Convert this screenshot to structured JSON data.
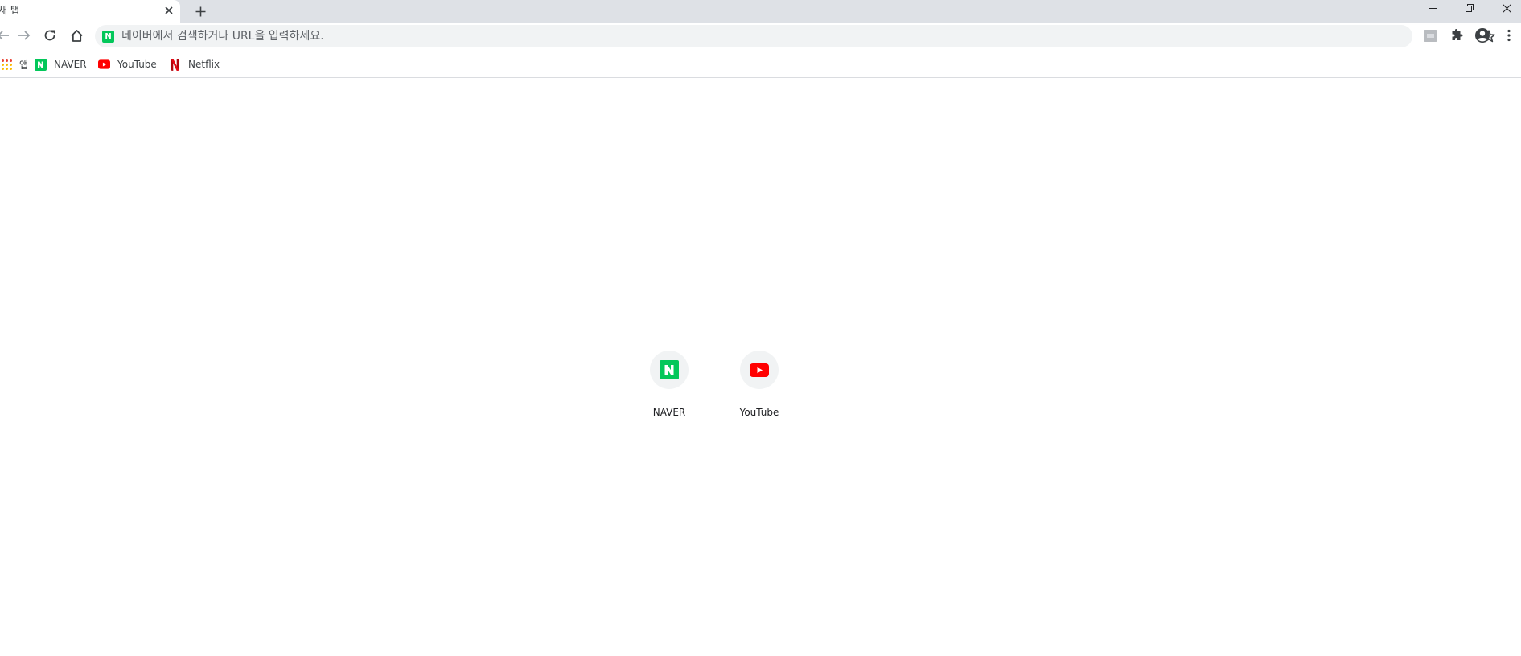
{
  "tab": {
    "title": "새 탭"
  },
  "omnibox": {
    "placeholder": "네이버에서 검색하거나 URL을 입력하세요."
  },
  "bookmarks": {
    "apps_label": "앱",
    "items": [
      {
        "label": "NAVER",
        "icon": "naver-icon"
      },
      {
        "label": "YouTube",
        "icon": "youtube-icon"
      },
      {
        "label": "Netflix",
        "icon": "netflix-icon"
      }
    ]
  },
  "tiles": [
    {
      "label": "NAVER",
      "icon": "naver-icon"
    },
    {
      "label": "YouTube",
      "icon": "youtube-icon"
    }
  ],
  "colors": {
    "naver_green": "#03c75a",
    "youtube_red": "#ff0000",
    "netflix_red": "#e50914",
    "tabstrip_bg": "#dee1e6",
    "omnibox_bg": "#f1f3f4"
  }
}
